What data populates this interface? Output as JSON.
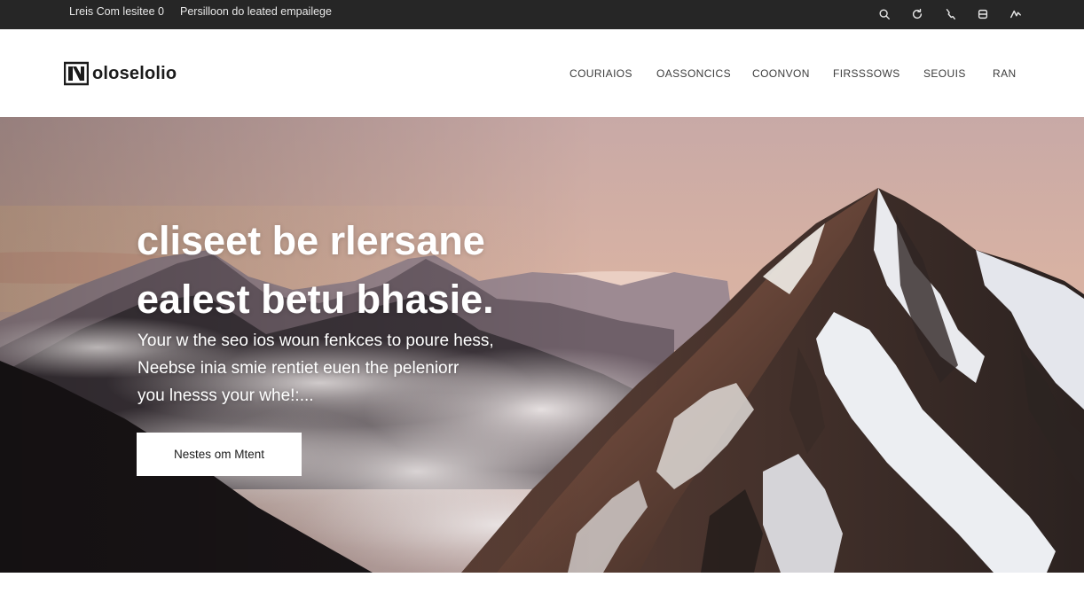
{
  "topbar": {
    "links": [
      "Lreis Com lesitee 0",
      "Persilloon do  leated empailege"
    ],
    "icons": [
      "search-icon",
      "refresh-icon",
      "phone-icon",
      "cart-icon",
      "signal-icon"
    ]
  },
  "header": {
    "logo_text": "oloselolio",
    "nav": [
      "COURIAIOS",
      "OASSONCICS",
      "COONVON",
      "FIRSSSOWS",
      "SEOUIS",
      "RAN"
    ]
  },
  "hero": {
    "title_lines": [
      "cliseet be rlersane",
      "ealest betu bhasie."
    ],
    "subtitle_lines": [
      "Your w the seo ios woun fenkces to poure hess,",
      "Neebse inia smie rentiet euen the peleniorr",
      "you lnesss your whe!:..."
    ],
    "cta_label": "Nestes om Mtent"
  },
  "colors": {
    "topbar_bg": "#262626",
    "header_bg": "#ffffff",
    "text_dark": "#1b1b1b",
    "hero_text": "#ffffff"
  }
}
